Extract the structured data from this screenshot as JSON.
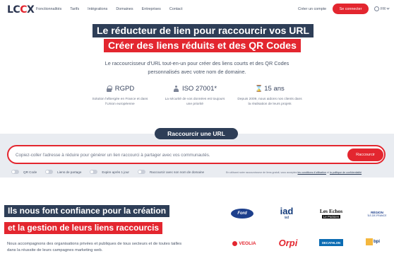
{
  "nav": {
    "logo_prefix": "LC",
    "logo_accent": "C",
    "logo_suffix": "X",
    "links": [
      "Fonctionnalités",
      "Tarifs",
      "Intégrations",
      "Domaines",
      "Entreprises",
      "Contact"
    ],
    "create_account": "Créer un compte",
    "connect": "Se connecter",
    "language": "FR"
  },
  "hero": {
    "title_line1": "Le réducteur de lien pour raccourcir vos URL",
    "title_line2": "Créer des liens réduits et des QR Codes",
    "lead": "Le raccourcisseur d'URL tout-en-un pour créer des liens courts et des QR Codes personnalisés avec votre nom de domaine."
  },
  "features": [
    {
      "icon": "lock-icon",
      "title": "RGPD",
      "desc": "Solution hébergée en France et dans l'Union européenne"
    },
    {
      "icon": "user-icon",
      "title": "ISO 27001*",
      "desc": "La sécurité de vos données est toujours une priorité"
    },
    {
      "icon": "hourglass-icon",
      "title": "15 ans",
      "desc": "Depuis 2009, nous aidons nos clients dans la réalisation de leurs projets"
    }
  ],
  "shortener": {
    "tab_label": "Raccourcir une URL",
    "placeholder": "Copiez-coller l'adresse à réduire pour générer un lien raccourci à partager avec vos communautés.",
    "button": "Raccourcir",
    "options": [
      "QR Code",
      "Liens de partage",
      "Expire après 1 jour",
      "Raccourcir avec son nom de domaine"
    ],
    "legal_prefix": "En utilisant notre raccourcisseur de liens gratuit, vous acceptez",
    "legal_terms": "les conditions d'utilisation",
    "legal_and": "et",
    "legal_policy": "la politique de confidentialité"
  },
  "trust": {
    "title_line1": "Ils nous font confiance pour la création",
    "title_line2": "et la gestion de leurs liens raccourcis",
    "para": "Nous accompagnons des organisations privées et publiques de tous secteurs et de toutes tailles dans la réussite de leurs campagnes marketing web."
  },
  "logos": {
    "ford": "Ford",
    "iad_big": "iad",
    "iad_small": "iad",
    "echos_a": "Les Echos",
    "echos_b": "Le Parisien",
    "region_a": "RÉGION",
    "region_b": "ÎLE-DE-FRANCE",
    "veolia": "VEOLIA",
    "orpi": "Orpi",
    "decathlon": "DECATHLON",
    "bpi": "bpi"
  },
  "colors": {
    "brand_red": "#e3262f",
    "navy": "#2e3e57"
  }
}
